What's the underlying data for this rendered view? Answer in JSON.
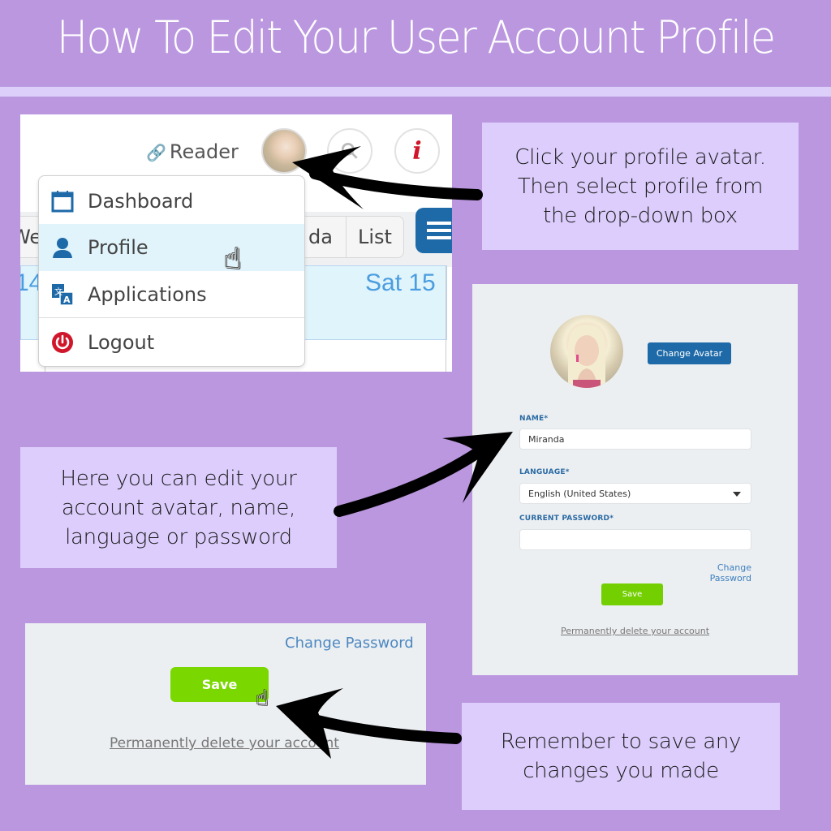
{
  "header": {
    "title": "How To Edit Your User Account Profile"
  },
  "callouts": {
    "step1": "Click your profile avatar.\nThen select profile from\nthe drop-down box",
    "step2": "Here you can edit your\naccount avatar, name,\nlanguage or password",
    "step3": "Remember to save any\nchanges you made"
  },
  "dropdown_screenshot": {
    "reader_label": "Reader",
    "reader_icon": "link-icon",
    "avatar_icon": "user-avatar",
    "search_icon": "search-icon",
    "info_icon_glyph": "i",
    "calendar_tabs": {
      "week": "Wee",
      "agenda": "da",
      "list": "List"
    },
    "day_left": "14",
    "day_right": "Sat 15",
    "menu_items": [
      {
        "label": "Dashboard",
        "icon": "calendar-icon"
      },
      {
        "label": "Profile",
        "icon": "user-icon",
        "highlighted": true
      },
      {
        "label": "Applications",
        "icon": "translate-icon"
      },
      {
        "label": "Logout",
        "icon": "power-icon"
      }
    ]
  },
  "profile_form": {
    "change_avatar_label": "Change Avatar",
    "name_label": "NAME*",
    "name_value": "Miranda",
    "language_label": "LANGUAGE*",
    "language_value": "English (United States)",
    "password_label": "CURRENT PASSWORD*",
    "password_value": "",
    "change_password_label": "Change Password",
    "save_label": "Save",
    "delete_label": "Permanently delete your account"
  },
  "save_zoom": {
    "change_password_label": "Change Password",
    "save_label": "Save",
    "delete_label": "Permanently delete your account"
  },
  "colors": {
    "background": "#bb97e0",
    "callout": "#dccdfc",
    "primary_blue": "#1e6aa8",
    "save_green": "#73cf00",
    "logout_red": "#d0162a"
  }
}
